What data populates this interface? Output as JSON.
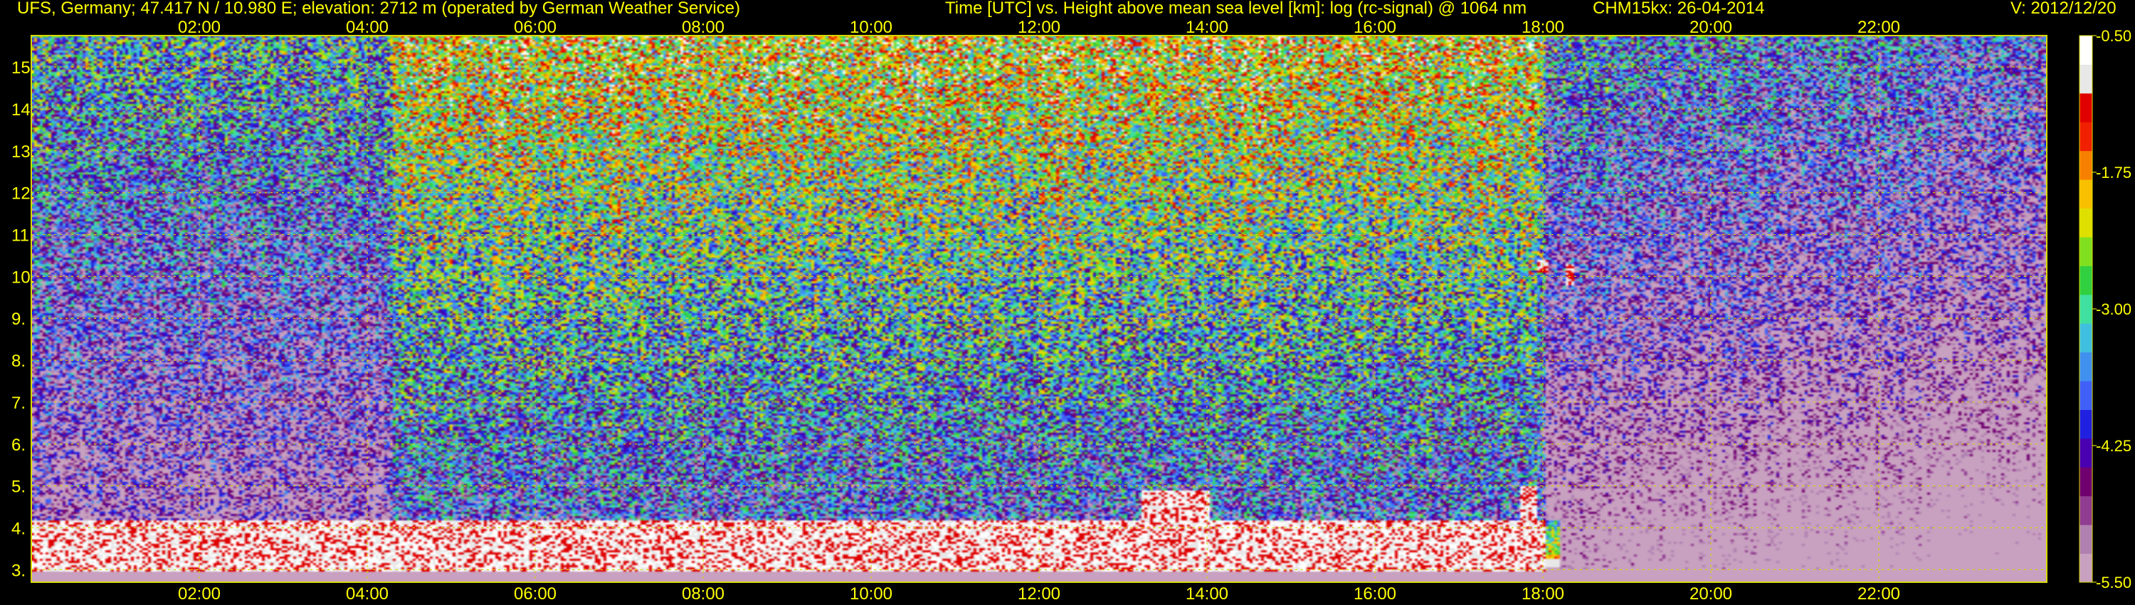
{
  "header": {
    "site": "UFS, Germany; 47.417 N / 10.980 E; elevation: 2712 m  (operated by German Weather Service)",
    "plot_title": "Time [UTC] vs. Height above mean sea level [km]: log (rc-signal) @ 1064 nm",
    "instrument_date": "CHM15kx: 26-04-2014",
    "version": "V: 2012/12/20"
  },
  "colors": {
    "text": "#FFFF00",
    "grid": "#D8D800",
    "background": "#000000",
    "colorbar": [
      "#C8A0C0",
      "#B080B0",
      "#903C90",
      "#700070",
      "#4800B0",
      "#2020E0",
      "#4060F8",
      "#4090F0",
      "#40C0E0",
      "#40E0A0",
      "#30D040",
      "#80E020",
      "#E0E000",
      "#F8C000",
      "#F88000",
      "#F02000",
      "#E00000",
      "#E8E8E8",
      "#FFFFFF"
    ]
  },
  "chart_data": {
    "type": "heatmap",
    "title": "Time [UTC] vs. Height above mean sea level [km]: log (rc-signal) @ 1064 nm",
    "xlabel": "Time [UTC]",
    "ylabel": "Height above mean sea level [km]",
    "xlim": [
      0,
      24
    ],
    "ylim": [
      2.7,
      15.75
    ],
    "xticks": [
      "02:00",
      "04:00",
      "06:00",
      "08:00",
      "10:00",
      "12:00",
      "14:00",
      "16:00",
      "18:00",
      "20:00",
      "22:00"
    ],
    "xtick_hours": [
      2,
      4,
      6,
      8,
      10,
      12,
      14,
      16,
      18,
      20,
      22
    ],
    "yticks": [
      "3.",
      "4.",
      "5.",
      "6.",
      "7.",
      "8.",
      "9.",
      "10.",
      "11.",
      "12.",
      "13.",
      "14.",
      "15."
    ],
    "ytick_values": [
      3,
      4,
      5,
      6,
      7,
      8,
      9,
      10,
      11,
      12,
      13,
      14,
      15
    ],
    "colorbar": {
      "label": "log (rc-signal)",
      "range": [
        -5.5,
        -0.5
      ],
      "ticks": [
        "-0.50",
        "-1.75",
        "-3.00",
        "-4.25",
        "-5.50"
      ],
      "tick_values": [
        -0.5,
        -1.75,
        -3.0,
        -4.25,
        -5.5
      ]
    },
    "features": [
      {
        "type": "boundary layer aerosol",
        "hour_range": [
          0,
          18
        ],
        "height_km": [
          3.0,
          4.2
        ]
      },
      {
        "type": "cloud",
        "hour_range": [
          13.2,
          14.0
        ],
        "height_km": [
          3.6,
          4.9
        ]
      },
      {
        "type": "cloud",
        "hour_range": [
          17.7,
          17.9
        ],
        "height_km": [
          3.5,
          5.0
        ]
      },
      {
        "type": "cloud",
        "hour_range": [
          17.9,
          18.05
        ],
        "height_km": [
          10.1,
          10.4
        ]
      },
      {
        "type": "cloud",
        "hour_range": [
          18.25,
          18.35
        ],
        "height_km": [
          9.8,
          10.3
        ]
      }
    ]
  }
}
